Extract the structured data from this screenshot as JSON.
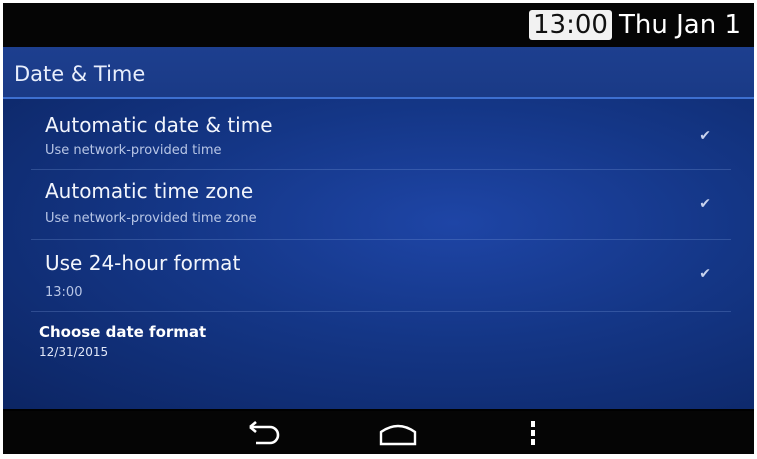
{
  "status_bar": {
    "time": "13:00",
    "date": "Thu Jan 1"
  },
  "header": {
    "title": "Date & Time"
  },
  "settings": [
    {
      "title": "Automatic date & time",
      "subtitle": "Use network-provided time",
      "checked": true
    },
    {
      "title": "Automatic time zone",
      "subtitle": "Use network-provided time zone",
      "checked": true
    },
    {
      "title": "Use 24-hour format",
      "subtitle": "13:00",
      "checked": true
    },
    {
      "title": "Choose date format",
      "subtitle": "12/31/2015"
    }
  ],
  "nav_bar": {
    "buttons": [
      "back-icon",
      "home-icon",
      "menu-icon"
    ]
  },
  "colors": {
    "header_bg": "#1d3f8f",
    "content_bg": "#143686",
    "bar_bg": "#050505"
  }
}
